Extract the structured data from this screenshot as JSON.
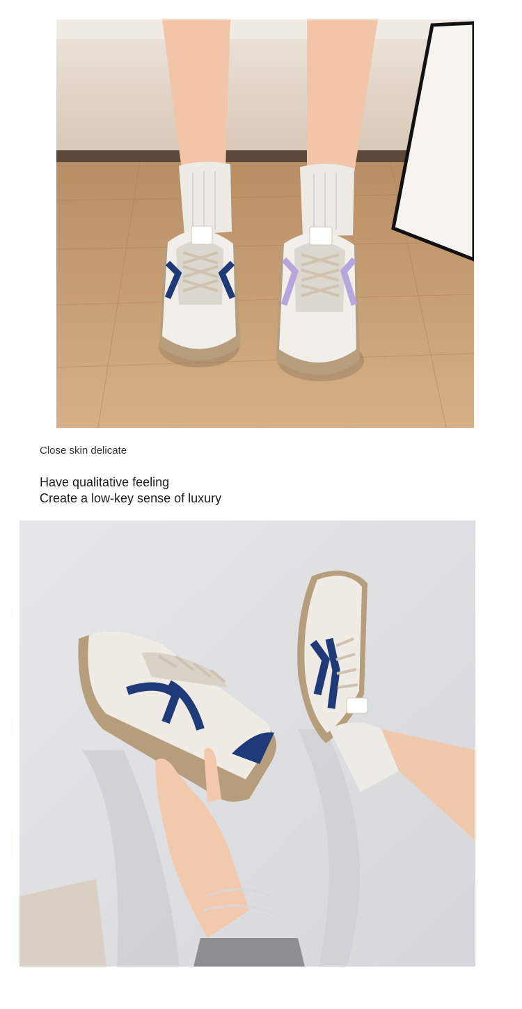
{
  "captions": {
    "small": "Close skin delicate",
    "line1": "Have qualitative feeling",
    "line2": "Create a low-key sense of luxury"
  },
  "photos": {
    "top_subject": "sneakers-worn-standing",
    "bottom_subject": "sneakers-held-and-worn"
  },
  "colors": {
    "accent_navy": "#1f3a78",
    "accent_lavender": "#b7a6dc",
    "sole_tan": "#b69d7b",
    "floor_wood": "#c89d72",
    "wall_gray": "#e3e4e6"
  }
}
